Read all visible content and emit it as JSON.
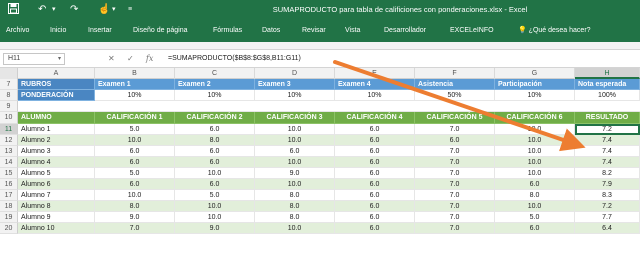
{
  "titlebar": {
    "title": "SUMAPRODUCTO para tabla de calificiones con ponderaciones.xlsx - Excel",
    "save_icon": "save-icon",
    "undo_icon": "undo-icon",
    "redo_icon": "redo-icon",
    "touch_icon": "touch-mode-icon",
    "customize_icon": "customize-qat-icon",
    "color": "#217346"
  },
  "ribbon": {
    "tabs": [
      {
        "label": "Archivo"
      },
      {
        "label": "Inicio"
      },
      {
        "label": "Insertar"
      },
      {
        "label": "Diseño de página"
      },
      {
        "label": "Fórmulas"
      },
      {
        "label": "Datos"
      },
      {
        "label": "Revisar"
      },
      {
        "label": "Vista"
      },
      {
        "label": "Desarrollador"
      },
      {
        "label": "EXCELeINFO"
      }
    ],
    "tellme": "¿Qué desea hacer?",
    "tellme_icon": "lightbulb-icon"
  },
  "formula_bar": {
    "name_box": "H11",
    "cancel_icon": "✕",
    "enter_icon": "✓",
    "fx_label": "fx",
    "formula": "=SUMAPRODUCTO($B$8:$G$8,B11:G11)"
  },
  "columns": [
    "A",
    "B",
    "C",
    "D",
    "E",
    "F",
    "G",
    "H"
  ],
  "active_column": "H",
  "header_rows": [
    {
      "num": "7",
      "cells": [
        "RUBROS",
        "Examen 1",
        "Examen 2",
        "Examen 3",
        "Examen 4",
        "Asistencia",
        "Participación",
        "Nota esperada"
      ]
    },
    {
      "num": "8",
      "cells": [
        "PONDERACIÓN",
        "10%",
        "10%",
        "10%",
        "10%",
        "50%",
        "10%",
        "100%"
      ]
    }
  ],
  "blank_row": {
    "num": "9"
  },
  "table_header": {
    "num": "10",
    "cells": [
      "ALUMNO",
      "CALIFICACIÓN 1",
      "CALIFICACIÓN 2",
      "CALIFICACIÓN 3",
      "CALIFICACIÓN 4",
      "CALIFICACIÓN 5",
      "CALIFICACIÓN 6",
      "RESULTADO"
    ]
  },
  "students": [
    {
      "num": "11",
      "cells": [
        "Alumno 1",
        "5.0",
        "6.0",
        "10.0",
        "6.0",
        "7.0",
        "10.0",
        "7.2"
      ]
    },
    {
      "num": "12",
      "cells": [
        "Alumno 2",
        "10.0",
        "8.0",
        "10.0",
        "6.0",
        "6.0",
        "10.0",
        "7.4"
      ]
    },
    {
      "num": "13",
      "cells": [
        "Alumno 3",
        "6.0",
        "6.0",
        "6.0",
        "6.0",
        "7.0",
        "10.0",
        "7.4"
      ]
    },
    {
      "num": "14",
      "cells": [
        "Alumno 4",
        "6.0",
        "6.0",
        "10.0",
        "6.0",
        "7.0",
        "10.0",
        "7.4"
      ]
    },
    {
      "num": "15",
      "cells": [
        "Alumno 5",
        "5.0",
        "10.0",
        "9.0",
        "6.0",
        "7.0",
        "10.0",
        "8.2"
      ]
    },
    {
      "num": "16",
      "cells": [
        "Alumno 6",
        "6.0",
        "6.0",
        "10.0",
        "6.0",
        "7.0",
        "6.0",
        "7.9"
      ]
    },
    {
      "num": "17",
      "cells": [
        "Alumno 7",
        "10.0",
        "5.0",
        "8.0",
        "6.0",
        "7.0",
        "8.0",
        "8.3"
      ]
    },
    {
      "num": "18",
      "cells": [
        "Alumno 8",
        "8.0",
        "10.0",
        "8.0",
        "6.0",
        "7.0",
        "10.0",
        "7.2"
      ]
    },
    {
      "num": "19",
      "cells": [
        "Alumno 9",
        "9.0",
        "10.0",
        "8.0",
        "6.0",
        "7.0",
        "5.0",
        "7.7"
      ]
    },
    {
      "num": "20",
      "cells": [
        "Alumno 10",
        "7.0",
        "9.0",
        "10.0",
        "6.0",
        "7.0",
        "6.0",
        "6.4"
      ]
    }
  ],
  "colors": {
    "blue_header": "#5b9bd5",
    "green_header": "#70ad47",
    "band": "#e2efda",
    "arrow": "#ed7d31",
    "excel_green": "#217346"
  }
}
